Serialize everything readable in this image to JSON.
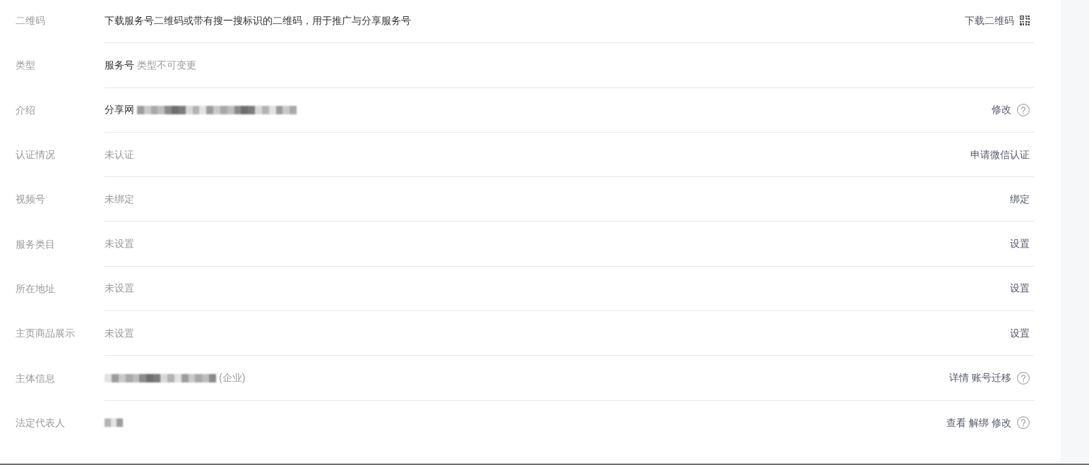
{
  "rows": [
    {
      "label": "二维码",
      "value": [
        {
          "kind": "text",
          "text": "下载服务号二维码或带有搜一搜标识的二维码，用于推广与分享服务号"
        }
      ],
      "actions": [
        {
          "kind": "download",
          "text": "下载二维码"
        }
      ],
      "help": false
    },
    {
      "label": "类型",
      "value": [
        {
          "kind": "text",
          "text": "服务号"
        },
        {
          "kind": "note",
          "text": "类型不可变更"
        }
      ],
      "help": false
    },
    {
      "label": "介绍",
      "value": [
        {
          "kind": "text",
          "text": "分享网"
        },
        {
          "kind": "redacted"
        }
      ],
      "actions": [
        {
          "kind": "link",
          "text": "修改"
        }
      ],
      "help": true
    },
    {
      "label": "认证情况",
      "value": [
        {
          "kind": "note",
          "text": "未认证"
        }
      ],
      "actions": [
        {
          "kind": "link",
          "text": "申请微信认证"
        }
      ],
      "help": false
    },
    {
      "label": "视频号",
      "value": [
        {
          "kind": "note",
          "text": "未绑定"
        }
      ],
      "actions": [
        {
          "kind": "link",
          "text": "绑定"
        }
      ],
      "help": false
    },
    {
      "label": "服务类目",
      "value": [
        {
          "kind": "note",
          "text": "未设置"
        }
      ],
      "actions": [
        {
          "kind": "link",
          "text": "设置"
        }
      ],
      "help": false
    },
    {
      "label": "所在地址",
      "value": [
        {
          "kind": "note",
          "text": "未设置"
        }
      ],
      "actions": [
        {
          "kind": "link",
          "text": "设置"
        }
      ],
      "help": false
    },
    {
      "label": "主页商品展示",
      "value": [
        {
          "kind": "note",
          "text": "未设置"
        }
      ],
      "actions": [
        {
          "kind": "link",
          "text": "设置"
        }
      ],
      "help": false
    },
    {
      "label": "主体信息",
      "value": [
        {
          "kind": "redacted"
        },
        {
          "kind": "note",
          "text": "(企业)"
        }
      ],
      "actions": [
        {
          "kind": "link",
          "text": "详情"
        },
        {
          "kind": "link",
          "text": "账号迁移"
        }
      ],
      "help": true
    },
    {
      "label": "法定代表人",
      "value": [
        {
          "kind": "redacted"
        }
      ],
      "actions": [
        {
          "kind": "link",
          "text": "查看"
        },
        {
          "kind": "link",
          "text": "解绑"
        },
        {
          "kind": "link",
          "text": "修改"
        }
      ],
      "help": true
    }
  ]
}
